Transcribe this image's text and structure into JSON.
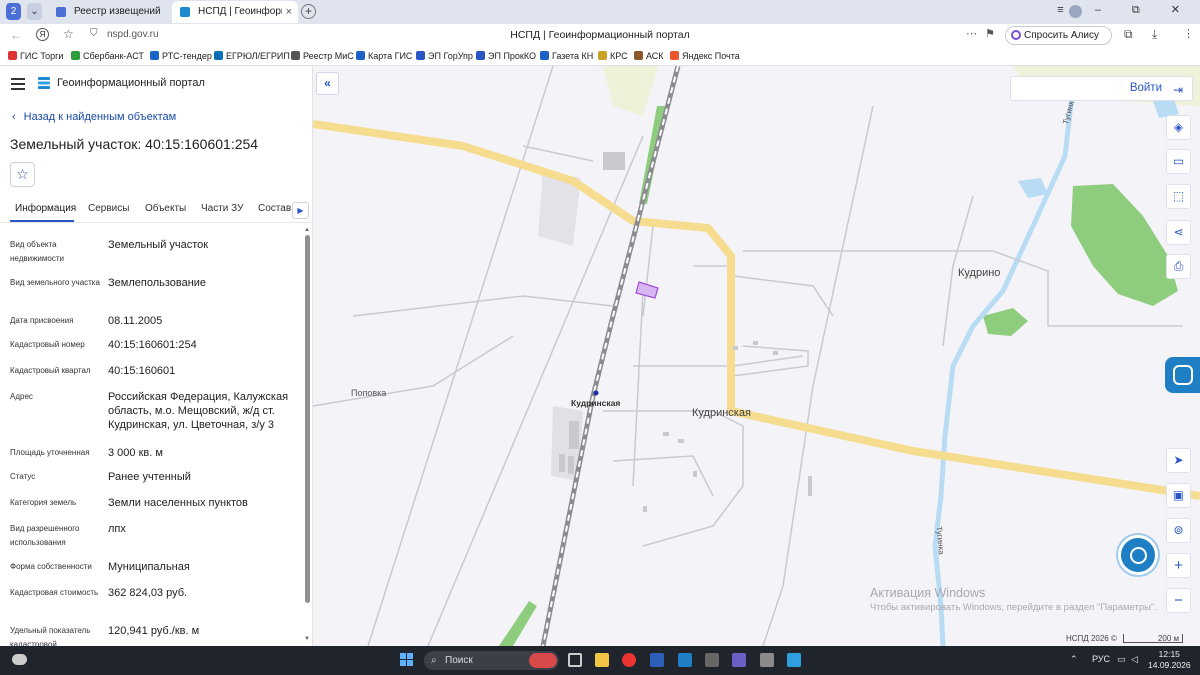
{
  "browser": {
    "tabs": [
      {
        "title": "Реестр извещений",
        "active": false
      },
      {
        "title": "НСПД | Геоинформаци",
        "active": true
      }
    ],
    "tab_counter": "2",
    "url": "nspd.gov.ru",
    "page_title": "НСПД | Геоинформационный портал",
    "alice_button": "Спросить Алису AI",
    "bookmarks": [
      {
        "label": "ГИС Торги",
        "color": "#d33"
      },
      {
        "label": "Сбербанк-АСТ",
        "color": "#2a9d3a"
      },
      {
        "label": "РТС-тендер",
        "color": "#1a63c4"
      },
      {
        "label": "ЕГРЮЛ/ЕГРИП",
        "color": "#0b6fb8"
      },
      {
        "label": "Реестр МиС",
        "color": "#555"
      },
      {
        "label": "Карта ГИС",
        "color": "#1a63c4"
      },
      {
        "label": "ЭП ГорУпр",
        "color": "#2a55c4"
      },
      {
        "label": "ЭП ПрокКО",
        "color": "#2a55c4"
      },
      {
        "label": "Газета КН",
        "color": "#1a63c4"
      },
      {
        "label": "КРС",
        "color": "#c9a227"
      },
      {
        "label": "АСК",
        "color": "#8a5a2b"
      },
      {
        "label": "Яндекс Почта",
        "color": "#e8542c"
      }
    ]
  },
  "panel": {
    "portal_name": "Геоинформационный портал",
    "back_link": "Назад к найденным объектам",
    "object_title": "Земельный участок: 40:15:160601:254",
    "tabs": [
      "Информация",
      "Сервисы",
      "Объекты",
      "Части ЗУ",
      "Состав"
    ],
    "properties": [
      {
        "key": "Вид объекта недвижимости",
        "value": "Земельный участок"
      },
      {
        "key": "Вид земельного участка",
        "value": "Землепользование"
      },
      {
        "key": "Дата присвоения",
        "value": "08.11.2005"
      },
      {
        "key": "Кадастровый номер",
        "value": "40:15:160601:254"
      },
      {
        "key": "Кадастровый квартал",
        "value": "40:15:160601"
      },
      {
        "key": "Адрес",
        "value": "Российская Федерация, Калужская область, м.о. Мещовский, ж/д ст. Кудринская, ул. Цветочная, з/у 3"
      },
      {
        "key": "Площадь уточненная",
        "value": "3 000 кв. м"
      },
      {
        "key": "Статус",
        "value": "Ранее учтенный"
      },
      {
        "key": "Категория земель",
        "value": "Земли населенных пунктов"
      },
      {
        "key": "Вид разрешенного использования",
        "value": "лпх"
      },
      {
        "key": "Форма собственности",
        "value": "Муниципальная"
      },
      {
        "key": "Кадастровая стоимость",
        "value": "362 824,03 руб."
      },
      {
        "key": "Удельный показатель кадастровой",
        "value": "120,941 руб./кв. м"
      }
    ]
  },
  "map": {
    "login_label": "Войти",
    "labels": {
      "kudrino": "Кудрино",
      "popovka": "Поповка",
      "kudrinskaya_station": "Кудринская",
      "kudrinskaya": "Кудринская",
      "tuganka_north": "Тугинка",
      "tuganka_south": "Тугинка"
    },
    "watermark_title": "Активация Windows",
    "watermark_text": "Чтобы активировать Windows, перейдите в раздел \"Параметры\".",
    "copyright": "НСПД 2026 ©",
    "scale": "200 м",
    "colors": {
      "road": "#f6dc8e",
      "parcel": "#d8b6f2",
      "green": "#8ecc7e",
      "water": "#b9dcf5",
      "accent": "#2a55c4"
    }
  },
  "taskbar": {
    "search_placeholder": "Поиск",
    "language": "РУС",
    "time": "12:15",
    "date": "14.09.2026"
  }
}
